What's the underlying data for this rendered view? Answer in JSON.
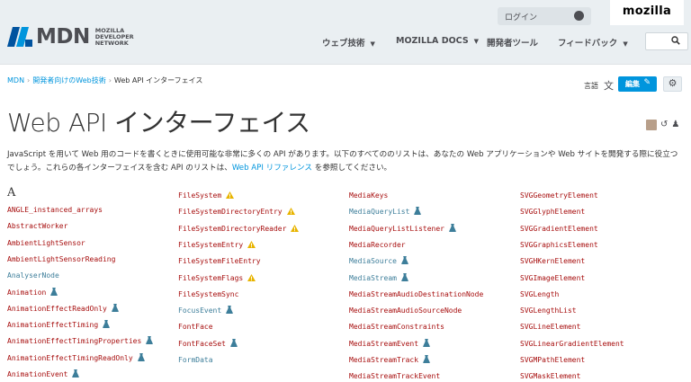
{
  "header": {
    "logo_text": "MDN",
    "logo_sub": "MOZILLA DEVELOPER NETWORK",
    "login_label": "ログイン",
    "mozilla_label": "mozilla",
    "nav": [
      {
        "label": "ウェブ技術"
      },
      {
        "label": "MOZILLA DOCS"
      },
      {
        "label": "開発者ツール"
      },
      {
        "label": "フィードバック"
      }
    ]
  },
  "breadcrumb": {
    "items": [
      "MDN",
      "開発者向けのWeb技術"
    ],
    "current": "Web API インターフェイス"
  },
  "toolbar": {
    "lang_label": "言語",
    "edit_label": "編集"
  },
  "page": {
    "title": "Web API インターフェイス",
    "intro_text": "JavaScript を用いて Web 用のコードを書くときに使用可能な非常に多くの API があります。以下のすべてののリストは、あなたの Web アプリケーションや Web サイトを開発する際に役立つでしょう。これらの各インターフェイスを含む API のリストは、",
    "intro_link": "Web API リファレンス",
    "intro_tail": " を参照してください。",
    "index_letter": "A"
  },
  "columns": [
    [
      {
        "name": "ANGLE_instanced_arrays",
        "style": "red",
        "badge": ""
      },
      {
        "name": "AbstractWorker",
        "style": "red",
        "badge": ""
      },
      {
        "name": "AmbientLightSensor",
        "style": "red",
        "badge": ""
      },
      {
        "name": "AmbientLightSensorReading",
        "style": "red",
        "badge": ""
      },
      {
        "name": "AnalyserNode",
        "style": "blue",
        "badge": ""
      },
      {
        "name": "Animation",
        "style": "red",
        "badge": "experimental"
      },
      {
        "name": "AnimationEffectReadOnly",
        "style": "red",
        "badge": "experimental"
      },
      {
        "name": "AnimationEffectTiming",
        "style": "red",
        "badge": "experimental"
      },
      {
        "name": "AnimationEffectTimingProperties",
        "style": "red",
        "badge": "experimental"
      },
      {
        "name": "AnimationEffectTimingReadOnly",
        "style": "red",
        "badge": "experimental"
      },
      {
        "name": "AnimationEvent",
        "style": "red",
        "badge": "experimental"
      }
    ],
    [
      {
        "name": "FileSystem",
        "style": "red",
        "badge": "warning"
      },
      {
        "name": "FileSystemDirectoryEntry",
        "style": "red",
        "badge": "warning"
      },
      {
        "name": "FileSystemDirectoryReader",
        "style": "red",
        "badge": "warning"
      },
      {
        "name": "FileSystemEntry",
        "style": "red",
        "badge": "warning"
      },
      {
        "name": "FileSystemFileEntry",
        "style": "red",
        "badge": ""
      },
      {
        "name": "FileSystemFlags",
        "style": "red",
        "badge": "warning"
      },
      {
        "name": "FileSystemSync",
        "style": "red",
        "badge": ""
      },
      {
        "name": "FocusEvent",
        "style": "blue",
        "badge": "experimental"
      },
      {
        "name": "FontFace",
        "style": "red",
        "badge": ""
      },
      {
        "name": "FontFaceSet",
        "style": "red",
        "badge": "experimental"
      },
      {
        "name": "FormData",
        "style": "blue",
        "badge": ""
      }
    ],
    [
      {
        "name": "MediaKeys",
        "style": "red",
        "badge": ""
      },
      {
        "name": "MediaQueryList",
        "style": "blue",
        "badge": "experimental"
      },
      {
        "name": "MediaQueryListListener",
        "style": "red",
        "badge": "experimental"
      },
      {
        "name": "MediaRecorder",
        "style": "red",
        "badge": ""
      },
      {
        "name": "MediaSource",
        "style": "blue",
        "badge": "experimental"
      },
      {
        "name": "MediaStream",
        "style": "blue",
        "badge": "experimental"
      },
      {
        "name": "MediaStreamAudioDestinationNode",
        "style": "red",
        "badge": ""
      },
      {
        "name": "MediaStreamAudioSourceNode",
        "style": "red",
        "badge": ""
      },
      {
        "name": "MediaStreamConstraints",
        "style": "red",
        "badge": ""
      },
      {
        "name": "MediaStreamEvent",
        "style": "red",
        "badge": "experimental"
      },
      {
        "name": "MediaStreamTrack",
        "style": "red",
        "badge": "experimental"
      },
      {
        "name": "MediaStreamTrackEvent",
        "style": "red",
        "badge": ""
      }
    ],
    [
      {
        "name": "SVGGeometryElement",
        "style": "red",
        "badge": ""
      },
      {
        "name": "SVGGlyphElement",
        "style": "red",
        "badge": ""
      },
      {
        "name": "SVGGradientElement",
        "style": "red",
        "badge": ""
      },
      {
        "name": "SVGGraphicsElement",
        "style": "red",
        "badge": ""
      },
      {
        "name": "SVGHKernElement",
        "style": "red",
        "badge": ""
      },
      {
        "name": "SVGImageElement",
        "style": "red",
        "badge": ""
      },
      {
        "name": "SVGLength",
        "style": "red",
        "badge": ""
      },
      {
        "name": "SVGLengthList",
        "style": "red",
        "badge": ""
      },
      {
        "name": "SVGLineElement",
        "style": "red",
        "badge": ""
      },
      {
        "name": "SVGLinearGradientElement",
        "style": "red",
        "badge": ""
      },
      {
        "name": "SVGMPathElement",
        "style": "red",
        "badge": ""
      },
      {
        "name": "SVGMaskElement",
        "style": "red",
        "badge": ""
      }
    ]
  ],
  "colors": {
    "link_red": "#a70e0e",
    "link_blue": "#3d7e9a",
    "accent": "#0095dd",
    "header_bg": "#eaeff2"
  }
}
